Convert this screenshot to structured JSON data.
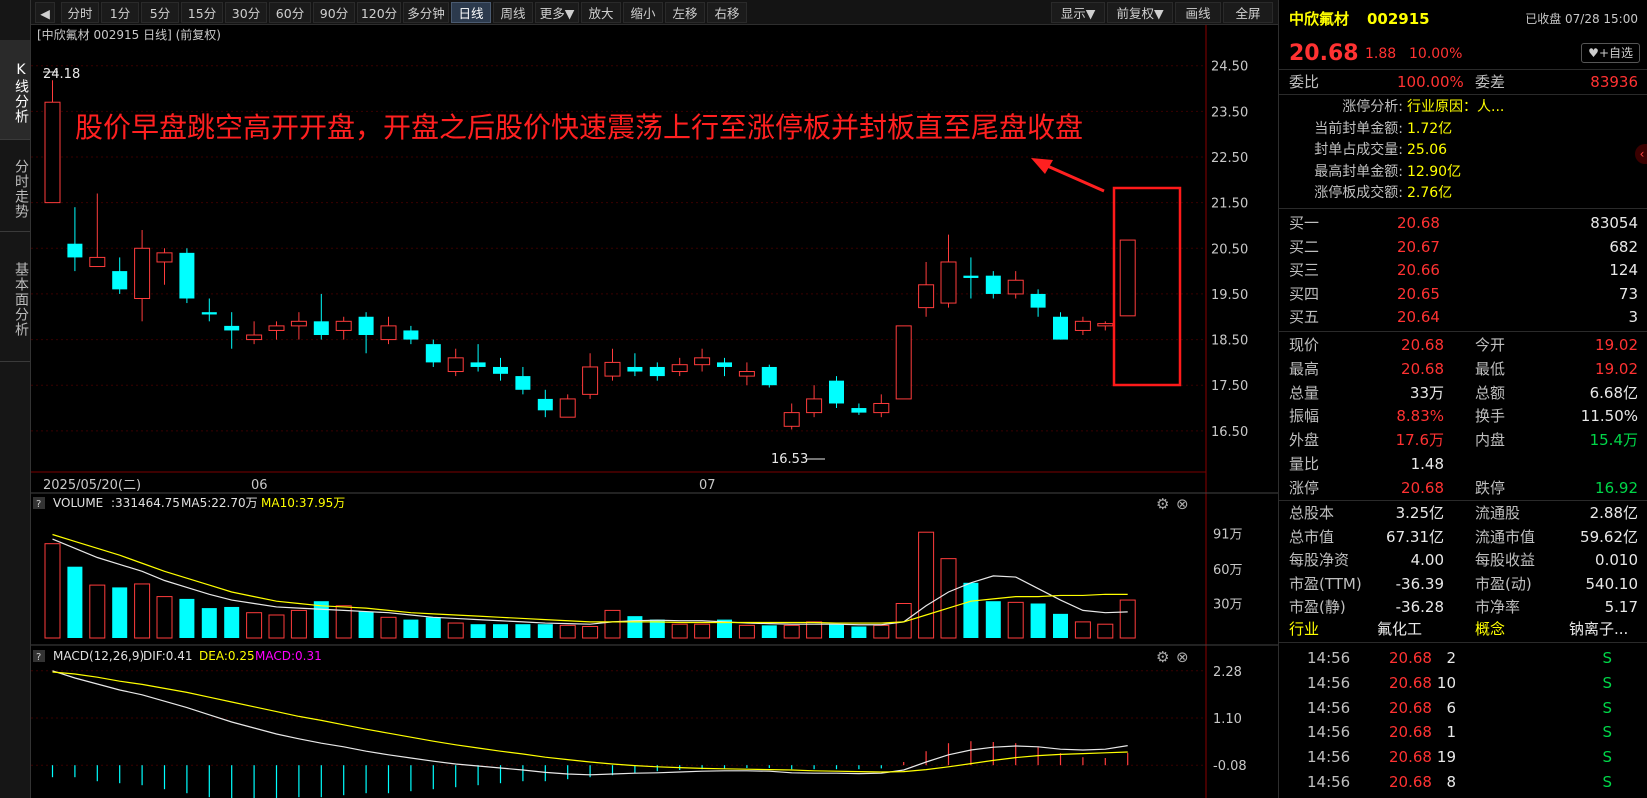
{
  "side_tabs": [
    "K线分析",
    "分时走势",
    "基本面分析"
  ],
  "toolbar": {
    "back_icon": "back-arrow-icon",
    "buttons": [
      "分时",
      "1分",
      "5分",
      "15分",
      "30分",
      "60分",
      "90分",
      "120分",
      "多分钟",
      "日线",
      "周线",
      "更多▼",
      "放大",
      "缩小",
      "左移",
      "右移"
    ],
    "active": "日线",
    "right_buttons": [
      "显示▼",
      "前复权▼",
      "画线",
      "全屏"
    ]
  },
  "chart": {
    "header": "[中欣氟材 002915 日线]  (前复权)",
    "annotation": "股价早盘跳空高开开盘，开盘之后股价快速震荡上行至涨停板并封板直至尾盘收盘",
    "high_label": "24.18",
    "low_label": "16.53",
    "price_ticks": [
      "24.50",
      "23.50",
      "22.50",
      "21.50",
      "20.50",
      "19.50",
      "18.50",
      "17.50",
      "16.50"
    ],
    "date_labels": [
      "2025/05/20(二)",
      "06",
      "07"
    ],
    "annotation_color": "#ff2020",
    "up_color": "#ff3c3c",
    "down_color": "#00ffff"
  },
  "volume": {
    "label": "VOLUME",
    "value": ":331464.75",
    "ma5": "MA5:22.70万",
    "ma10": "MA10:37.95万",
    "ticks": [
      "91万",
      "60万",
      "30万"
    ]
  },
  "macd": {
    "label": "MACD(12,26,9)",
    "dif": "DIF:0.41",
    "dea": "DEA:0.25",
    "macd": "MACD:0.31",
    "ticks": [
      "2.28",
      "1.10",
      "-0.08"
    ]
  },
  "chart_data": {
    "type": "candlestick",
    "ylim": [
      16.3,
      24.8
    ],
    "candles": [
      {
        "o": 21.5,
        "c": 23.7,
        "h": 24.18,
        "l": 21.5
      },
      {
        "o": 20.6,
        "c": 20.3,
        "h": 21.4,
        "l": 20.0
      },
      {
        "o": 20.1,
        "c": 20.3,
        "h": 21.7,
        "l": 20.1
      },
      {
        "o": 20.0,
        "c": 19.6,
        "h": 20.3,
        "l": 19.5
      },
      {
        "o": 19.4,
        "c": 20.5,
        "h": 20.9,
        "l": 18.9
      },
      {
        "o": 20.2,
        "c": 20.4,
        "h": 20.5,
        "l": 19.7
      },
      {
        "o": 20.4,
        "c": 19.4,
        "h": 20.5,
        "l": 19.3
      },
      {
        "o": 19.1,
        "c": 19.05,
        "h": 19.4,
        "l": 18.9
      },
      {
        "o": 18.8,
        "c": 18.7,
        "h": 19.1,
        "l": 18.3
      },
      {
        "o": 18.5,
        "c": 18.6,
        "h": 18.9,
        "l": 18.4
      },
      {
        "o": 18.7,
        "c": 18.8,
        "h": 18.9,
        "l": 18.5
      },
      {
        "o": 18.8,
        "c": 18.9,
        "h": 19.1,
        "l": 18.5
      },
      {
        "o": 18.9,
        "c": 18.6,
        "h": 19.5,
        "l": 18.5
      },
      {
        "o": 18.7,
        "c": 18.9,
        "h": 19.0,
        "l": 18.5
      },
      {
        "o": 19.0,
        "c": 18.6,
        "h": 19.1,
        "l": 18.2
      },
      {
        "o": 18.5,
        "c": 18.8,
        "h": 19.0,
        "l": 18.4
      },
      {
        "o": 18.7,
        "c": 18.5,
        "h": 18.8,
        "l": 18.4
      },
      {
        "o": 18.4,
        "c": 18.0,
        "h": 18.5,
        "l": 17.9
      },
      {
        "o": 17.8,
        "c": 18.1,
        "h": 18.3,
        "l": 17.7
      },
      {
        "o": 18.0,
        "c": 17.9,
        "h": 18.4,
        "l": 17.8
      },
      {
        "o": 17.9,
        "c": 17.75,
        "h": 18.1,
        "l": 17.6
      },
      {
        "o": 17.7,
        "c": 17.4,
        "h": 17.9,
        "l": 17.3
      },
      {
        "o": 17.2,
        "c": 16.95,
        "h": 17.4,
        "l": 16.8
      },
      {
        "o": 16.8,
        "c": 17.2,
        "h": 17.3,
        "l": 16.8
      },
      {
        "o": 17.3,
        "c": 17.9,
        "h": 18.2,
        "l": 17.2
      },
      {
        "o": 17.7,
        "c": 18.0,
        "h": 18.3,
        "l": 17.6
      },
      {
        "o": 17.9,
        "c": 17.8,
        "h": 18.2,
        "l": 17.7
      },
      {
        "o": 17.9,
        "c": 17.7,
        "h": 18.0,
        "l": 17.6
      },
      {
        "o": 17.8,
        "c": 17.95,
        "h": 18.1,
        "l": 17.7
      },
      {
        "o": 17.95,
        "c": 18.1,
        "h": 18.3,
        "l": 17.8
      },
      {
        "o": 18.0,
        "c": 17.9,
        "h": 18.1,
        "l": 17.7
      },
      {
        "o": 17.7,
        "c": 17.8,
        "h": 18.0,
        "l": 17.5
      },
      {
        "o": 17.9,
        "c": 17.5,
        "h": 17.95,
        "l": 17.45
      },
      {
        "o": 16.6,
        "c": 16.9,
        "h": 17.1,
        "l": 16.53
      },
      {
        "o": 16.9,
        "c": 17.2,
        "h": 17.5,
        "l": 16.8
      },
      {
        "o": 17.6,
        "c": 17.1,
        "h": 17.7,
        "l": 17.0
      },
      {
        "o": 17.0,
        "c": 16.9,
        "h": 17.1,
        "l": 16.85
      },
      {
        "o": 16.9,
        "c": 17.1,
        "h": 17.3,
        "l": 16.8
      },
      {
        "o": 17.2,
        "c": 18.8,
        "h": 18.8,
        "l": 17.2
      },
      {
        "o": 19.2,
        "c": 19.7,
        "h": 20.2,
        "l": 19.0
      },
      {
        "o": 19.3,
        "c": 20.2,
        "h": 20.8,
        "l": 19.2
      },
      {
        "o": 19.9,
        "c": 19.85,
        "h": 20.3,
        "l": 19.4
      },
      {
        "o": 19.9,
        "c": 19.5,
        "h": 20.0,
        "l": 19.4
      },
      {
        "o": 19.5,
        "c": 19.8,
        "h": 20.0,
        "l": 19.4
      },
      {
        "o": 19.5,
        "c": 19.2,
        "h": 19.6,
        "l": 19.0
      },
      {
        "o": 19.0,
        "c": 18.5,
        "h": 19.1,
        "l": 18.5
      },
      {
        "o": 18.7,
        "c": 18.9,
        "h": 19.0,
        "l": 18.6
      },
      {
        "o": 18.8,
        "c": 18.85,
        "h": 18.9,
        "l": 18.7
      },
      {
        "o": 19.02,
        "c": 20.68,
        "h": 20.68,
        "l": 19.02
      }
    ],
    "volume_ylim": [
      0,
      100
    ],
    "volumes": [
      82,
      62,
      46,
      44,
      47,
      36,
      34,
      26,
      27,
      22,
      20,
      24,
      32,
      28,
      23,
      18,
      16,
      18,
      13,
      12,
      12,
      12,
      12,
      11,
      10,
      24,
      19,
      16,
      12,
      12,
      16,
      11,
      11,
      11,
      14,
      12,
      10,
      11,
      30,
      92,
      69,
      48,
      32,
      31,
      30,
      21,
      14,
      12,
      33
    ],
    "volume_ma5": [
      86,
      78,
      70,
      64,
      58,
      50,
      44,
      38,
      33,
      30,
      27,
      26,
      25,
      24,
      23,
      22,
      20,
      18,
      17,
      16,
      15,
      14,
      13,
      12.5,
      12,
      14,
      15,
      15.5,
      15,
      15,
      14,
      13,
      12.5,
      12,
      12,
      12,
      11.5,
      11.5,
      14,
      28,
      40,
      48,
      54,
      53,
      43,
      33,
      24,
      22,
      22.7
    ],
    "volume_ma10": [
      90,
      84,
      78,
      72,
      65,
      58,
      52,
      46,
      40,
      36,
      32,
      30,
      28,
      27,
      26,
      24,
      22,
      21,
      20,
      19,
      18,
      17,
      16,
      15,
      14,
      14,
      14,
      14,
      13.5,
      13.5,
      13.5,
      13.5,
      13.5,
      13.5,
      13.5,
      13,
      13,
      13,
      14,
      20,
      26,
      32,
      34,
      36,
      36,
      37,
      37,
      38,
      37.95
    ],
    "macd_ylim": [
      -0.9,
      2.35
    ],
    "dif": [
      2.28,
      2.1,
      1.95,
      1.8,
      1.68,
      1.52,
      1.36,
      1.18,
      1.0,
      0.85,
      0.7,
      0.58,
      0.47,
      0.38,
      0.27,
      0.18,
      0.1,
      0.02,
      -0.05,
      -0.1,
      -0.15,
      -0.2,
      -0.26,
      -0.3,
      -0.32,
      -0.3,
      -0.28,
      -0.27,
      -0.25,
      -0.23,
      -0.22,
      -0.22,
      -0.23,
      -0.27,
      -0.28,
      -0.28,
      -0.29,
      -0.28,
      -0.2,
      0.0,
      0.18,
      0.3,
      0.37,
      0.4,
      0.38,
      0.32,
      0.3,
      0.32,
      0.41
    ],
    "dea": [
      2.25,
      2.2,
      2.12,
      2.02,
      1.94,
      1.84,
      1.74,
      1.62,
      1.5,
      1.38,
      1.26,
      1.14,
      1.04,
      0.93,
      0.82,
      0.72,
      0.62,
      0.52,
      0.43,
      0.35,
      0.27,
      0.2,
      0.12,
      0.06,
      0.0,
      -0.05,
      -0.09,
      -0.12,
      -0.14,
      -0.16,
      -0.17,
      -0.18,
      -0.19,
      -0.2,
      -0.22,
      -0.23,
      -0.24,
      -0.25,
      -0.24,
      -0.19,
      -0.12,
      -0.04,
      0.04,
      0.11,
      0.16,
      0.19,
      0.21,
      0.23,
      0.25
    ],
    "macd_hist": [
      -0.3,
      -0.3,
      -0.4,
      -0.45,
      -0.5,
      -0.6,
      -0.7,
      -0.8,
      -0.85,
      -0.85,
      -0.85,
      -0.8,
      -0.8,
      -0.75,
      -0.7,
      -0.7,
      -0.65,
      -0.6,
      -0.55,
      -0.5,
      -0.45,
      -0.4,
      -0.4,
      -0.35,
      -0.3,
      -0.25,
      -0.2,
      -0.15,
      -0.12,
      -0.1,
      -0.08,
      -0.07,
      -0.07,
      -0.1,
      -0.1,
      -0.1,
      -0.1,
      -0.08,
      0.08,
      0.35,
      0.55,
      0.6,
      0.58,
      0.55,
      0.45,
      0.3,
      0.2,
      0.18,
      0.31
    ]
  },
  "quote": {
    "name": "中欣氟材",
    "code": "002915",
    "status": "已收盘 07/28 15:00",
    "price": "20.68",
    "change": "1.88",
    "change_pct": "10.00%",
    "watch_button": "+自选",
    "weibi_label": "委比",
    "weibi": "100.00%",
    "weicha_label": "委差",
    "weicha": "83936"
  },
  "limit_up": [
    {
      "label": "涨停分析:",
      "value": "行业原因：人..."
    },
    {
      "label": "当前封单金额:",
      "value": "1.72亿"
    },
    {
      "label": "封单占成交量:",
      "value": "25.06"
    },
    {
      "label": "最高封单金额:",
      "value": "12.90亿"
    },
    {
      "label": "涨停板成交额:",
      "value": "2.76亿"
    }
  ],
  "bids": [
    {
      "label": "买一",
      "price": "20.68",
      "vol": "83054"
    },
    {
      "label": "买二",
      "price": "20.67",
      "vol": "682"
    },
    {
      "label": "买三",
      "price": "20.66",
      "vol": "124"
    },
    {
      "label": "买四",
      "price": "20.65",
      "vol": "73"
    },
    {
      "label": "买五",
      "price": "20.64",
      "vol": "3"
    }
  ],
  "stats": [
    {
      "l1": "现价",
      "v1": "20.68",
      "c1": "red",
      "l2": "今开",
      "v2": "19.02",
      "c2": "red"
    },
    {
      "l1": "最高",
      "v1": "20.68",
      "c1": "red",
      "l2": "最低",
      "v2": "19.02",
      "c2": "red"
    },
    {
      "l1": "总量",
      "v1": "33万",
      "c1": "white",
      "l2": "总额",
      "v2": "6.68亿",
      "c2": "white"
    },
    {
      "l1": "振幅",
      "v1": "8.83%",
      "c1": "red",
      "l2": "换手",
      "v2": "11.50%",
      "c2": "white"
    },
    {
      "l1": "外盘",
      "v1": "17.6万",
      "c1": "red",
      "l2": "内盘",
      "v2": "15.4万",
      "c2": "green"
    },
    {
      "l1": "量比",
      "v1": "1.48",
      "c1": "white",
      "l2": "",
      "v2": "",
      "c2": "white"
    },
    {
      "l1": "涨停",
      "v1": "20.68",
      "c1": "red",
      "l2": "跌停",
      "v2": "16.92",
      "c2": "green"
    }
  ],
  "fundamentals": [
    {
      "l1": "总股本",
      "v1": "3.25亿",
      "l2": "流通股",
      "v2": "2.88亿"
    },
    {
      "l1": "总市值",
      "v1": "67.31亿",
      "l2": "流通市值",
      "v2": "59.62亿"
    },
    {
      "l1": "每股净资",
      "v1": "4.00",
      "l2": "每股收益",
      "v2": "0.010"
    },
    {
      "l1": "市盈(TTM)",
      "v1": "-36.39",
      "l2": "市盈(动)",
      "v2": "540.10"
    },
    {
      "l1": "市盈(静)",
      "v1": "-36.28",
      "l2": "市净率",
      "v2": "5.17"
    }
  ],
  "industry": {
    "label": "行业",
    "value": "氟化工",
    "concept_label": "概念",
    "concept": "钠离子..."
  },
  "trades": [
    {
      "time": "14:56",
      "price": "20.68",
      "vol": "2",
      "side": "S"
    },
    {
      "time": "14:56",
      "price": "20.68",
      "vol": "10",
      "side": "S"
    },
    {
      "time": "14:56",
      "price": "20.68",
      "vol": "6",
      "side": "S"
    },
    {
      "time": "14:56",
      "price": "20.68",
      "vol": "1",
      "side": "S"
    },
    {
      "time": "14:56",
      "price": "20.68",
      "vol": "19",
      "side": "S"
    },
    {
      "time": "14:56",
      "price": "20.68",
      "vol": "8",
      "side": "S"
    }
  ]
}
